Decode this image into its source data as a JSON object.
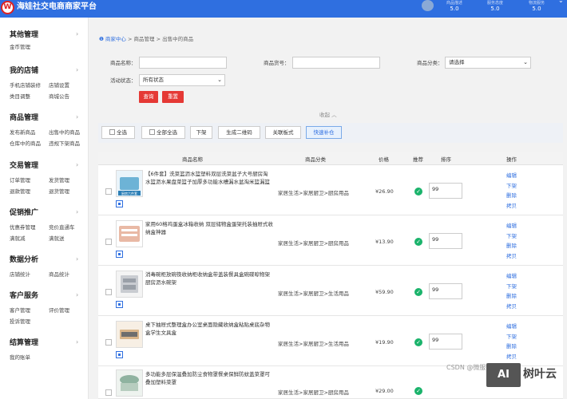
{
  "header": {
    "logo_text": "W",
    "title": "海娃社交电商商家平台",
    "stats": [
      {
        "label": "商品描述",
        "value": "5.0"
      },
      {
        "label": "服务态度",
        "value": "5.0"
      },
      {
        "label": "物流服务",
        "value": "5.0"
      }
    ]
  },
  "sidebar": {
    "groups": [
      {
        "title": "其他管理",
        "items": [
          "金币管理"
        ]
      },
      {
        "title": "我的店铺",
        "items": [
          "手机店铺装修",
          "店铺设置",
          "类目调整",
          "商城公告"
        ]
      },
      {
        "title": "商品管理",
        "items": [
          "发布新商品",
          "出售中的商品",
          "仓库中的商品",
          "违规下架商品"
        ]
      },
      {
        "title": "交易管理",
        "items": [
          "订单管理",
          "发货管理",
          "退款管理",
          "退货管理"
        ]
      },
      {
        "title": "促销推广",
        "items": [
          "优惠券管理",
          "竞价直通车",
          "满就减",
          "满就送"
        ]
      },
      {
        "title": "数据分析",
        "items": [
          "店铺统计",
          "商品统计"
        ]
      },
      {
        "title": "客户服务",
        "items": [
          "客户管理",
          "评价管理",
          "投诉管理"
        ]
      },
      {
        "title": "结算管理",
        "items": [
          "我的账单"
        ]
      }
    ]
  },
  "breadcrumb": {
    "home": "商家中心",
    "level1": "商品管理",
    "level2": "出售中的商品"
  },
  "filters": {
    "name_label": "商品名称：",
    "name_value": "",
    "code_label": "商品货号：",
    "code_value": "",
    "category_label": "商品分类：",
    "category_value": "请选择",
    "status_label": "活动状态：",
    "status_value": "所有状态",
    "query_button": "查询",
    "reset_button": "重置",
    "collapse_label": "收起"
  },
  "toolbar": {
    "select_all": "全选",
    "select_all_pages": "全部全选",
    "unlist": "下架",
    "gen_qr": "生成二维码",
    "related": "关联板式",
    "quick_stock": "快速补仓"
  },
  "table": {
    "headers": {
      "name": "商品名称",
      "category": "商品分类",
      "price": "价格",
      "recommend": "推荐",
      "sort": "排序",
      "ops": "操作"
    },
    "rows": [
      {
        "name": "【6件套】洗菜篮沥水篮塑料双层洗菜盆子大号厨房淘水篮沥水果盘菜篮子加厚多功能水槽漏水盆淘米篮漏篮",
        "category": "家居生活>家居厨卫>厨房用品",
        "price": "¥26.90",
        "sort": "99",
        "thumb_text": "厨房六件套",
        "thumb_color": "#6db3d6"
      },
      {
        "name": "家用60格鸡蛋盒冰箱收纳 双层储物盒蛋架托装抽屉式收纳盒神器",
        "category": "家居生活>家居厨卫>厨房用品",
        "price": "¥13.90",
        "sort": "99",
        "thumb_text": "",
        "thumb_color": "#e9b9a5"
      },
      {
        "name": "消毒碗柜放碗筷收纳柜收纳盒带盖装餐具盒碗碟晾物架厨房沥水碗架",
        "category": "家居生活>家居厨卫>生活用品",
        "price": "¥59.90",
        "sort": "99",
        "thumb_text": "",
        "thumb_color": "#c9ccd1"
      },
      {
        "name": "桌下抽屉式整理盒办公室桌面隐藏收纳盒粘贴桌底杂物盒学生文具盒",
        "category": "家居生活>家居厨卫>生活用品",
        "price": "¥19.90",
        "sort": "99",
        "thumb_text": "",
        "thumb_color": "#d9b58a"
      },
      {
        "name": "多功能多层保温叠加防尘食物罩餐桌保鲜防蚊盖菜罩可叠加塑料菜罩",
        "category": "家居生活>家居厨卫>厨房用品",
        "price": "¥29.00",
        "sort": "99",
        "thumb_text": "",
        "thumb_color": "#8fb3a0"
      }
    ],
    "ops": [
      "编辑",
      "下架",
      "删除",
      "拷贝"
    ]
  },
  "watermark": {
    "csdn": "CSDN @微服务技术分享",
    "logo": "AI",
    "brand": "树叶云"
  }
}
